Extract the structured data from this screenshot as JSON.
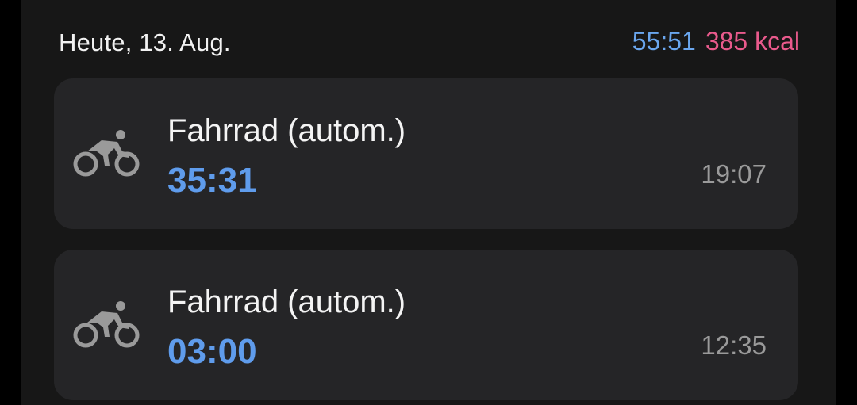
{
  "header": {
    "date": "Heute, 13. Aug.",
    "total_duration": "55:51",
    "total_kcal": "385 kcal"
  },
  "colors": {
    "duration_blue": "#5f9cec",
    "kcal_pink": "#e95a8c",
    "card_background": "#252527",
    "panel_background": "#171717"
  },
  "activities": [
    {
      "icon": "bicycle-icon",
      "title": "Fahrrad (autom.)",
      "duration": "35:31",
      "start_time": "19:07"
    },
    {
      "icon": "bicycle-icon",
      "title": "Fahrrad (autom.)",
      "duration": "03:00",
      "start_time": "12:35"
    }
  ]
}
